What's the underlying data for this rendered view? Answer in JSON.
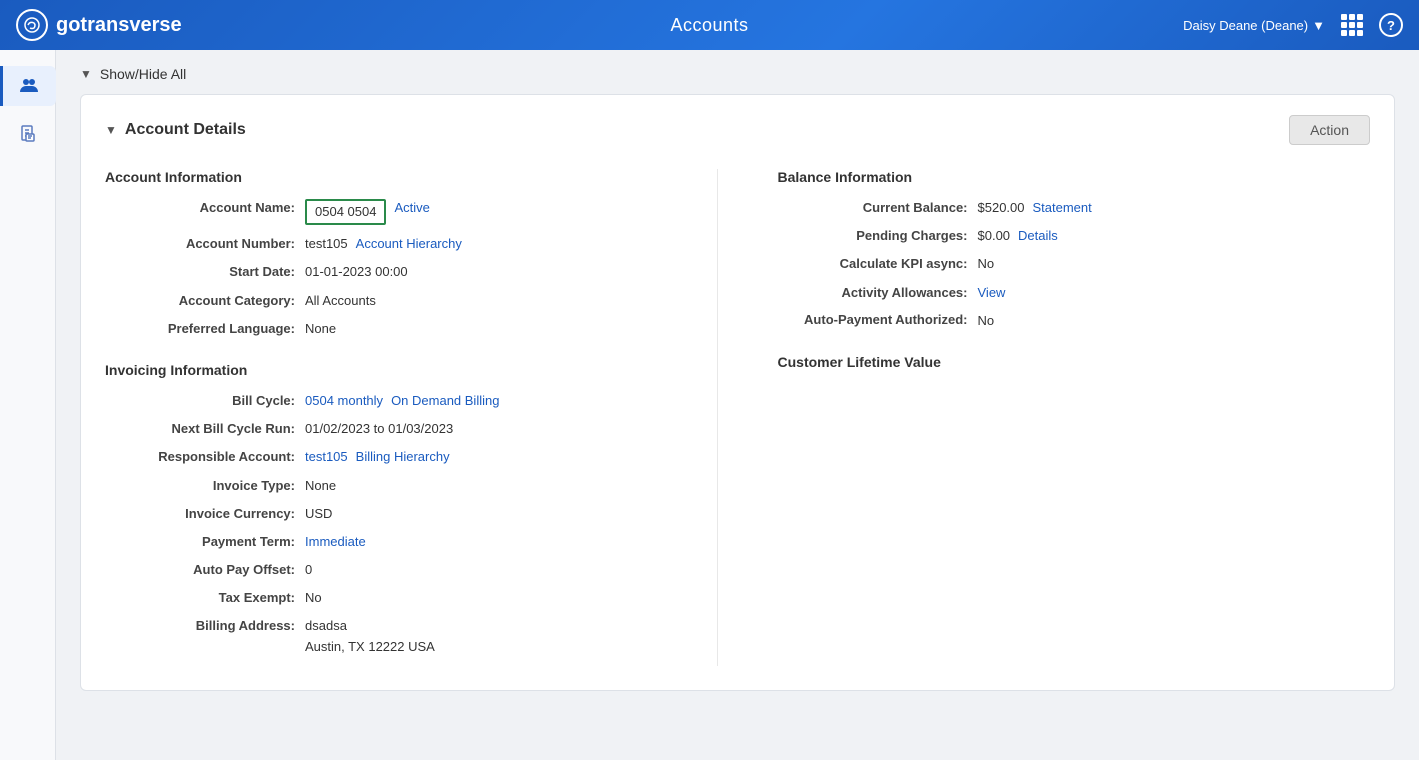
{
  "app": {
    "name": "gotransverse",
    "logo_letter": "g",
    "page_title": "Accounts",
    "user": "Daisy Deane (Deane)",
    "user_dropdown": true
  },
  "sidebar": {
    "items": [
      {
        "name": "users",
        "icon": "👤",
        "active": true
      },
      {
        "name": "documents",
        "icon": "📄",
        "active": false
      }
    ]
  },
  "toolbar": {
    "show_hide_label": "Show/Hide All"
  },
  "account_details": {
    "section_title": "Account Details",
    "action_button_label": "Action",
    "account_information": {
      "heading": "Account Information",
      "account_name_label": "Account Name:",
      "account_name_value": "0504 0504",
      "account_status": "Active",
      "account_number_label": "Account Number:",
      "account_number_value": "test105",
      "account_hierarchy_link": "Account Hierarchy",
      "start_date_label": "Start Date:",
      "start_date_value": "01-01-2023 00:00",
      "account_category_label": "Account Category:",
      "account_category_value": "All Accounts",
      "preferred_language_label": "Preferred Language:",
      "preferred_language_value": "None"
    },
    "balance_information": {
      "heading": "Balance Information",
      "current_balance_label": "Current Balance:",
      "current_balance_value": "$520.00",
      "statement_link": "Statement",
      "pending_charges_label": "Pending Charges:",
      "pending_charges_value": "$0.00",
      "details_link": "Details",
      "calculate_kpi_label": "Calculate KPI async:",
      "calculate_kpi_value": "No",
      "activity_allowances_label": "Activity Allowances:",
      "activity_allowances_link": "View",
      "auto_payment_label": "Auto-Payment Authorized:",
      "auto_payment_value": "No"
    },
    "invoicing_information": {
      "heading": "Invoicing Information",
      "bill_cycle_label": "Bill Cycle:",
      "bill_cycle_value": "0504 monthly",
      "on_demand_billing_link": "On Demand Billing",
      "next_bill_cycle_label": "Next Bill Cycle Run:",
      "next_bill_cycle_value": "01/02/2023 to 01/03/2023",
      "responsible_account_label": "Responsible Account:",
      "responsible_account_value": "test105",
      "billing_hierarchy_link": "Billing Hierarchy",
      "invoice_type_label": "Invoice Type:",
      "invoice_type_value": "None",
      "invoice_currency_label": "Invoice Currency:",
      "invoice_currency_value": "USD",
      "payment_term_label": "Payment Term:",
      "payment_term_link": "Immediate",
      "auto_pay_offset_label": "Auto Pay Offset:",
      "auto_pay_offset_value": "0",
      "tax_exempt_label": "Tax Exempt:",
      "tax_exempt_value": "No",
      "billing_address_label": "Billing Address:",
      "billing_address_line1": "dsadsa",
      "billing_address_line2": "Austin, TX 12222 USA"
    },
    "customer_lifetime_value": {
      "heading": "Customer Lifetime Value"
    }
  }
}
